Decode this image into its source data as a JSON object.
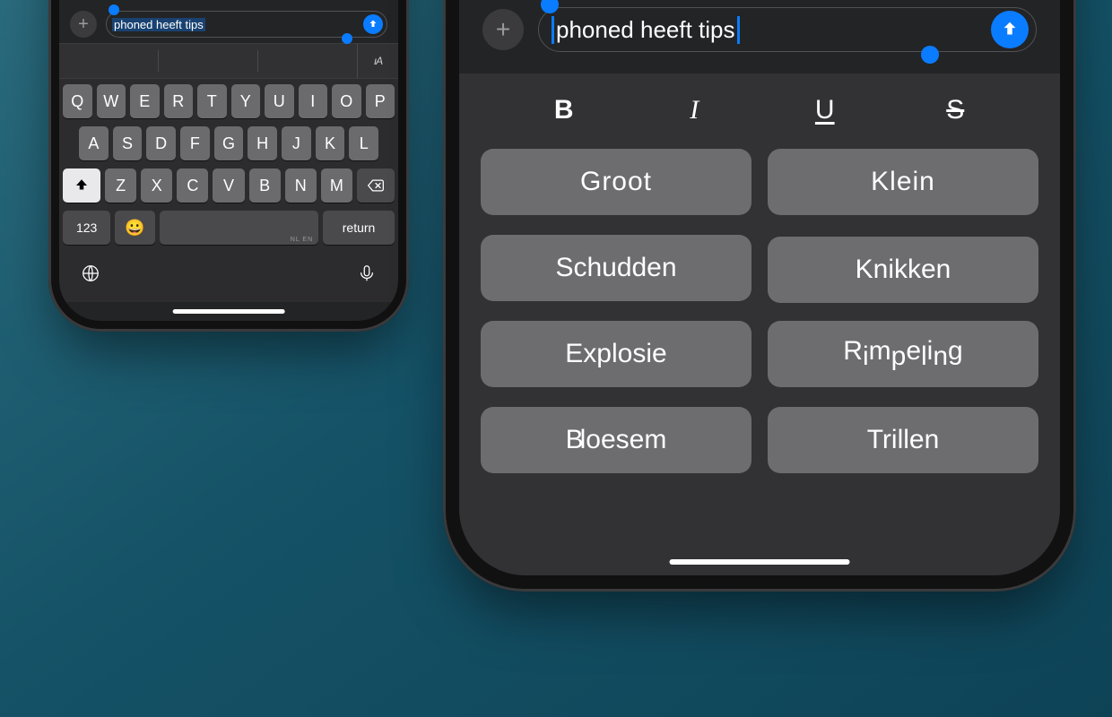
{
  "colors": {
    "accent": "#0a7cff"
  },
  "message_text": "phoned heeft tips",
  "left_phone": {
    "space_lang_hint": "NL EN",
    "keys": {
      "row1": [
        "Q",
        "W",
        "E",
        "R",
        "T",
        "Y",
        "U",
        "I",
        "O",
        "P"
      ],
      "row2": [
        "A",
        "S",
        "D",
        "F",
        "G",
        "H",
        "J",
        "K",
        "L"
      ],
      "row3": [
        "Z",
        "X",
        "C",
        "V",
        "B",
        "N",
        "M"
      ],
      "num": "123",
      "return": "return",
      "emoji": "😀"
    },
    "format_toggle": "ıA"
  },
  "right_phone": {
    "format_bar": {
      "bold": "B",
      "italic": "I",
      "underline": "U",
      "strike": "S"
    },
    "effects": [
      {
        "id": "groot",
        "label": "Groot"
      },
      {
        "id": "klein",
        "label": "Klein"
      },
      {
        "id": "schudden",
        "label": "Schudden"
      },
      {
        "id": "knikken",
        "label": "Knikken"
      },
      {
        "id": "explosie",
        "label": "Explosie"
      },
      {
        "id": "rimpeling",
        "label": "Rimpeling"
      },
      {
        "id": "bloesem",
        "label": "Bloesem"
      },
      {
        "id": "trillen",
        "label": "Trillen"
      }
    ]
  }
}
